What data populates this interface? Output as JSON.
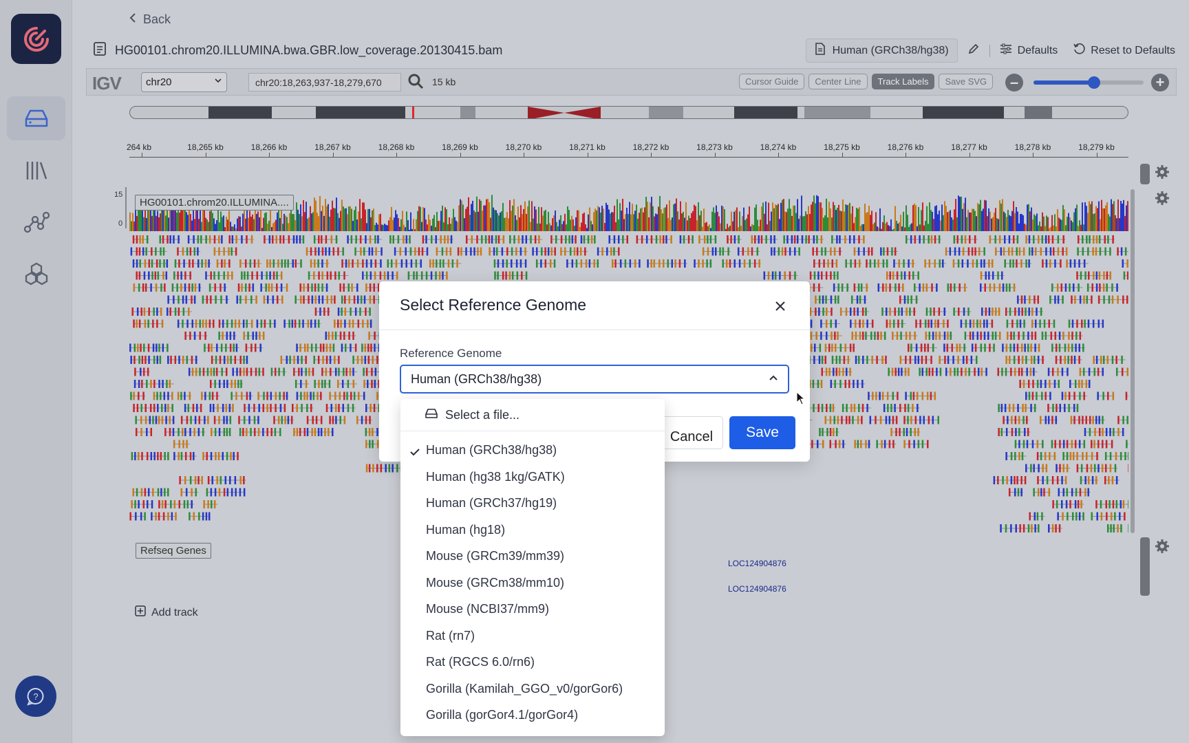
{
  "header": {
    "back_label": "Back",
    "file_name": "HG00101.chrom20.ILLUMINA.bwa.GBR.low_coverage.20130415.bam",
    "genome_chip": "Human (GRCh38/hg38)",
    "defaults_label": "Defaults",
    "reset_label": "Reset to Defaults"
  },
  "igv": {
    "logo": "IGV",
    "chromosome": "chr20",
    "locus": "chr20:18,263,937-18,279,670",
    "span": "15 kb",
    "buttons": {
      "cursor_guide": "Cursor Guide",
      "center_line": "Center Line",
      "track_labels": "Track Labels",
      "save_svg": "Save SVG"
    },
    "zoom_level": 0.55,
    "ruler_ticks": [
      "264 kb",
      "18,265 kb",
      "18,266 kb",
      "18,267 kb",
      "18,268 kb",
      "18,269 kb",
      "18,270 kb",
      "18,271 kb",
      "18,272 kb",
      "18,273 kb",
      "18,274 kb",
      "18,275 kb",
      "18,276 kb",
      "18,277 kb",
      "18,278 kb",
      "18,279 kb"
    ],
    "coverage_max": "15",
    "coverage_min": "0",
    "alignment_track_label": "HG00101.chrom20.ILLUMINA....",
    "gene_track_label": "Refseq Genes",
    "gene_labels": [
      "LOC124904876",
      "LOC124904876"
    ],
    "add_track_label": "Add track"
  },
  "modal": {
    "title": "Select Reference Genome",
    "field_label": "Reference Genome",
    "selected_value": "Human (GRCh38/hg38)",
    "cancel_label": "Cancel",
    "save_label": "Save"
  },
  "dropdown": {
    "file_option": "Select a file...",
    "selected_index": 0,
    "options": [
      "Human (GRCh38/hg38)",
      "Human (hg38 1kg/GATK)",
      "Human (GRCh37/hg19)",
      "Human (hg18)",
      "Mouse (GRCm39/mm39)",
      "Mouse (GRCm38/mm10)",
      "Mouse (NCBI37/mm9)",
      "Rat (rn7)",
      "Rat (RGCS 6.0/rn6)",
      "Gorilla (Kamilah_GGO_v0/gorGor6)",
      "Gorilla (gorGor4.1/gorGor4)"
    ]
  },
  "colors": {
    "accent": "#1e5de6",
    "logo_bg": "#1c2443",
    "gene": "#1b2a8a",
    "base_a": "#2e8b3a",
    "base_c": "#2637c8",
    "base_g": "#c87a1c",
    "base_t": "#c8232c"
  },
  "icons": {
    "rail": [
      "storage-icon",
      "library-icon",
      "graph-icon",
      "hexagons-icon"
    ],
    "help": "chat-help-icon"
  }
}
